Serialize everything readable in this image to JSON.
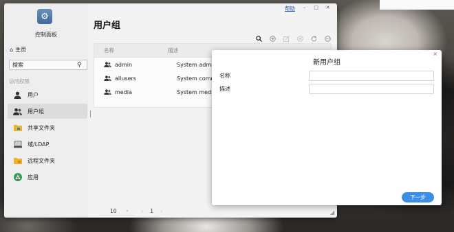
{
  "window": {
    "app_title": "控制面板",
    "help_label": "帮助",
    "minimize": "–",
    "maximize": "□",
    "close": "✕"
  },
  "sidebar": {
    "home_label": "主页",
    "search_placeholder": "搜索",
    "section_label": "访问权限",
    "items": [
      {
        "label": "用户",
        "icon": "user-icon"
      },
      {
        "label": "用户组",
        "icon": "user-group-icon",
        "active": true
      },
      {
        "label": "共享文件夹",
        "icon": "shared-folder-icon"
      },
      {
        "label": "域/LDAP",
        "icon": "domain-ldap-icon"
      },
      {
        "label": "远程文件夹",
        "icon": "remote-folder-icon"
      },
      {
        "label": "应用",
        "icon": "app-icon"
      }
    ]
  },
  "main": {
    "title": "用户组",
    "table": {
      "columns": [
        "名称",
        "描述"
      ],
      "rows": [
        {
          "name": "admin",
          "description": "System admini"
        },
        {
          "name": "allusers",
          "description": "System commo"
        },
        {
          "name": "media",
          "description": "System media a"
        }
      ]
    },
    "pager": {
      "page_size": "10",
      "page": "1"
    }
  },
  "dialog": {
    "title": "新用户组",
    "close": "×",
    "name_label": "名称",
    "name_value": "",
    "desc_label": "描述",
    "desc_value": "",
    "next_label": "下一步"
  },
  "colors": {
    "accent": "#3d8fe6",
    "link": "#2a5db0"
  }
}
